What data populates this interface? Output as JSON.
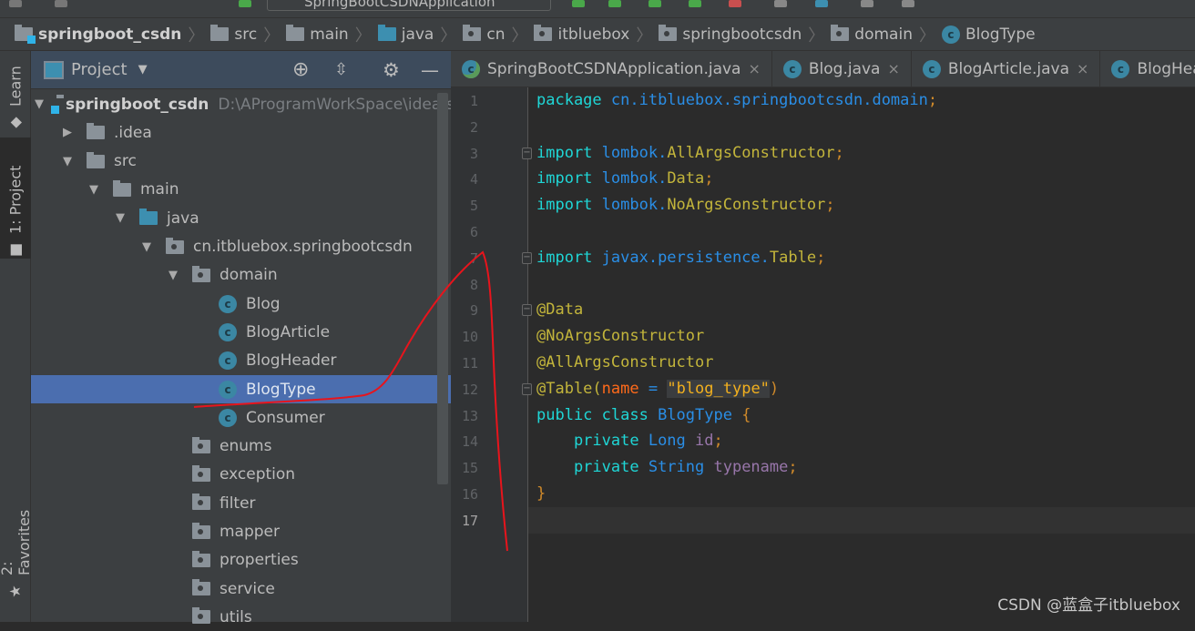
{
  "toolbar": {
    "run_config": "SpringBootCSDNApplication"
  },
  "breadcrumb": [
    {
      "label": "springboot_csdn",
      "icon": "module-folder"
    },
    {
      "label": "src",
      "icon": "folder"
    },
    {
      "label": "main",
      "icon": "folder"
    },
    {
      "label": "java",
      "icon": "source-folder"
    },
    {
      "label": "cn",
      "icon": "package"
    },
    {
      "label": "itbluebox",
      "icon": "package"
    },
    {
      "label": "springbootcsdn",
      "icon": "package"
    },
    {
      "label": "domain",
      "icon": "package"
    },
    {
      "label": "BlogType",
      "icon": "class"
    }
  ],
  "left_strip": {
    "learn": "Learn",
    "project": "1: Project",
    "favorites": "2: Favorites"
  },
  "project_panel": {
    "title": "Project",
    "tree": [
      {
        "label": "springboot_csdn",
        "path": "D:\\AProgramWorkSpace\\idea\\s",
        "level": 0,
        "toggle": "expanded",
        "icon": "module-folder",
        "bold": true
      },
      {
        "label": ".idea",
        "level": 1,
        "toggle": "collapsed",
        "icon": "folder"
      },
      {
        "label": "src",
        "level": 1,
        "toggle": "expanded",
        "icon": "folder"
      },
      {
        "label": "main",
        "level": 2,
        "toggle": "expanded",
        "icon": "folder"
      },
      {
        "label": "java",
        "level": 3,
        "toggle": "expanded",
        "icon": "source-folder"
      },
      {
        "label": "cn.itbluebox.springbootcsdn",
        "level": 4,
        "toggle": "expanded",
        "icon": "package"
      },
      {
        "label": "domain",
        "level": 5,
        "toggle": "expanded",
        "icon": "package"
      },
      {
        "label": "Blog",
        "level": 6,
        "icon": "class"
      },
      {
        "label": "BlogArticle",
        "level": 6,
        "icon": "class"
      },
      {
        "label": "BlogHeader",
        "level": 6,
        "icon": "class"
      },
      {
        "label": "BlogType",
        "level": 6,
        "icon": "class",
        "selected": true
      },
      {
        "label": "Consumer",
        "level": 6,
        "icon": "class"
      },
      {
        "label": "enums",
        "level": 5,
        "icon": "package"
      },
      {
        "label": "exception",
        "level": 5,
        "icon": "package"
      },
      {
        "label": "filter",
        "level": 5,
        "icon": "package"
      },
      {
        "label": "mapper",
        "level": 5,
        "icon": "package"
      },
      {
        "label": "properties",
        "level": 5,
        "icon": "package"
      },
      {
        "label": "service",
        "level": 5,
        "icon": "package"
      },
      {
        "label": "utils",
        "level": 5,
        "icon": "package"
      }
    ]
  },
  "editor_tabs": [
    {
      "label": "SpringBootCSDNApplication.java",
      "icon": "spring-boot-class",
      "close": "×"
    },
    {
      "label": "Blog.java",
      "icon": "class",
      "close": "×"
    },
    {
      "label": "BlogArticle.java",
      "icon": "class",
      "close": "×"
    },
    {
      "label": "BlogHeac",
      "icon": "class"
    }
  ],
  "code": [
    [
      [
        "package ",
        "kw"
      ],
      [
        "cn.itbluebox.springbootcsdn.domain",
        "pk"
      ],
      [
        ";",
        "pu"
      ]
    ],
    [],
    [
      [
        "import ",
        "kw"
      ],
      [
        "lombok.",
        "pk"
      ],
      [
        "AllArgsConstructor",
        "ty"
      ],
      [
        ";",
        "pu"
      ]
    ],
    [
      [
        "import ",
        "kw"
      ],
      [
        "lombok.",
        "pk"
      ],
      [
        "Data",
        "ty"
      ],
      [
        ";",
        "pu"
      ]
    ],
    [
      [
        "import ",
        "kw"
      ],
      [
        "lombok.",
        "pk"
      ],
      [
        "NoArgsConstructor",
        "ty"
      ],
      [
        ";",
        "pu"
      ]
    ],
    [],
    [
      [
        "import ",
        "kw"
      ],
      [
        "javax.persistence.",
        "pk"
      ],
      [
        "Table",
        "ty"
      ],
      [
        ";",
        "pu"
      ]
    ],
    [],
    [
      [
        "@Data",
        "an"
      ]
    ],
    [
      [
        "@NoArgsConstructor",
        "an"
      ]
    ],
    [
      [
        "@AllArgsConstructor",
        "an"
      ]
    ],
    [
      [
        "@Table(",
        "an"
      ],
      [
        "name",
        "at"
      ],
      [
        " = ",
        "op"
      ],
      [
        "\"blog_type\"",
        "st"
      ],
      [
        ")",
        "pu"
      ]
    ],
    [
      [
        "public class ",
        "kw"
      ],
      [
        "BlogType ",
        "pk"
      ],
      [
        "{",
        "pu"
      ]
    ],
    [
      [
        "    private ",
        "kw"
      ],
      [
        "Long ",
        "pk"
      ],
      [
        "id",
        "fi"
      ],
      [
        ";",
        "pu"
      ]
    ],
    [
      [
        "    private ",
        "kw"
      ],
      [
        "String ",
        "pk"
      ],
      [
        "typename",
        "fi"
      ],
      [
        ";",
        "pu"
      ]
    ],
    [
      [
        "}",
        "pu"
      ]
    ],
    []
  ],
  "fold_markers": [
    3,
    7,
    9,
    12
  ],
  "current_line": 17,
  "watermark": "CSDN @蓝盒子itbluebox",
  "colors": {
    "selection": "#4b6eaf",
    "annotation_stroke": "#e8141c"
  }
}
